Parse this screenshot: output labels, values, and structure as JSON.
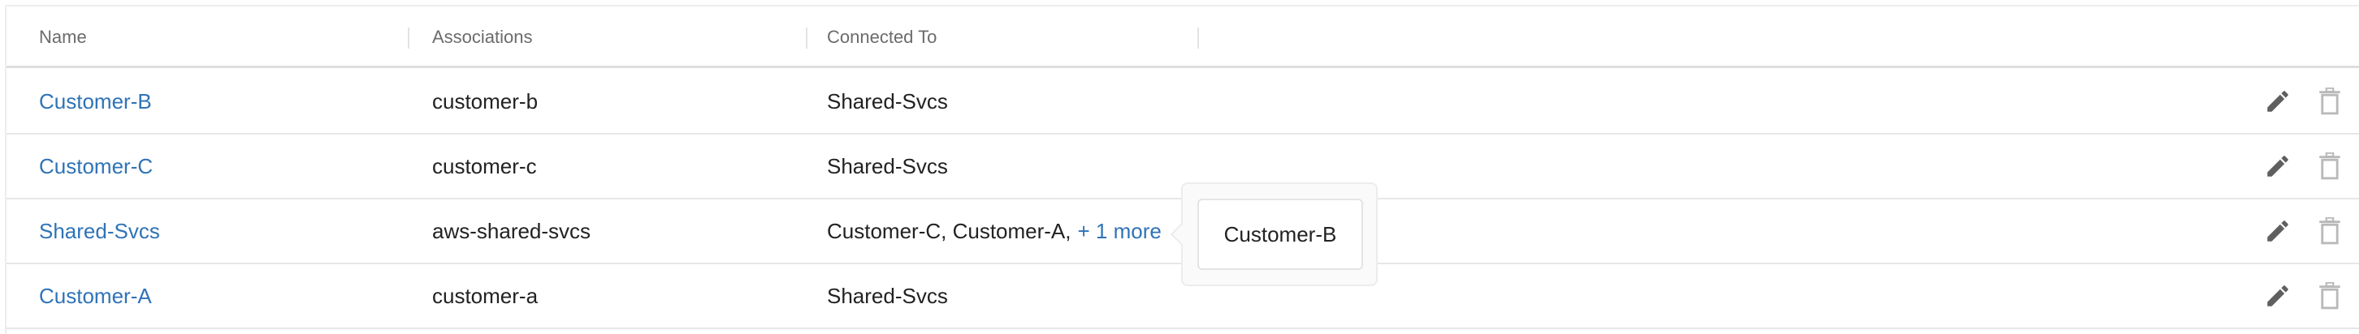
{
  "table": {
    "columns": [
      "Name",
      "Associations",
      "Connected To"
    ],
    "rows": [
      {
        "name": "Customer-B",
        "association": "customer-b",
        "connected_to": "Shared-Svcs",
        "more": ""
      },
      {
        "name": "Customer-C",
        "association": "customer-c",
        "connected_to": "Shared-Svcs",
        "more": ""
      },
      {
        "name": "Shared-Svcs",
        "association": "aws-shared-svcs",
        "connected_to": "Customer-C, Customer-A,",
        "more": "+ 1 more"
      },
      {
        "name": "Customer-A",
        "association": "customer-a",
        "connected_to": "Shared-Svcs",
        "more": ""
      }
    ]
  },
  "popover": {
    "items": [
      "Customer-B"
    ]
  },
  "icons": {
    "edit": "pencil-icon",
    "delete": "trash-icon"
  },
  "colors": {
    "link": "#2f73b7",
    "text": "#222222",
    "header_text": "#6b6b6b",
    "icon": "#5f5f5f",
    "icon_muted": "#b9b9b9"
  }
}
